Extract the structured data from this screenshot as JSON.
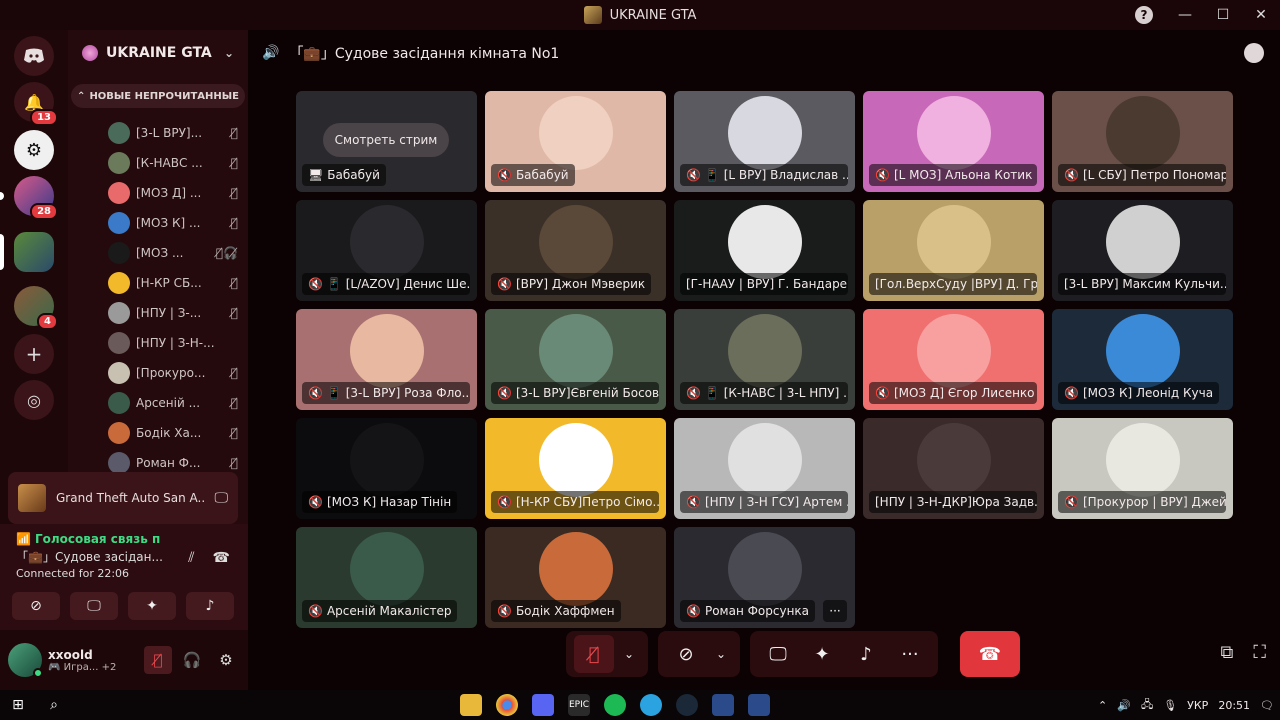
{
  "window": {
    "title": "UKRAINE GTA",
    "help_label": "?",
    "minimize": "—",
    "maximize": "☐",
    "close": "✕"
  },
  "rail": {
    "notifications_badge": "13",
    "server_badge_1": "28",
    "server_badge_2": "4"
  },
  "sidebar": {
    "server_name": "UKRAINE GTA",
    "unread_label": "НОВЫЕ НЕПРОЧИТАННЫЕ",
    "members": [
      {
        "name": "[3-L ВРУ]...",
        "color": "#4a6a5a"
      },
      {
        "name": "[К-НАВС ...",
        "color": "#6a7a5a"
      },
      {
        "name": "[МОЗ Д] ...",
        "color": "#e86a6a"
      },
      {
        "name": "[МОЗ К] ...",
        "color": "#3a7ac8"
      },
      {
        "name": "[МОЗ ...",
        "color": "#1a1a1a"
      },
      {
        "name": "[Н-КР СБ...",
        "color": "#f2b92a"
      },
      {
        "name": "[НПУ | З-...",
        "color": "#9a9a9a"
      },
      {
        "name": "[НПУ | З-Н-...",
        "color": "#6a5a5a"
      },
      {
        "name": "[Прокуро...",
        "color": "#c8c0b0"
      },
      {
        "name": "Арсеній ...",
        "color": "#3a5a4a"
      },
      {
        "name": "Бодік Ха...",
        "color": "#c86a3a"
      },
      {
        "name": "Роман Ф...",
        "color": "#5a5a6a"
      }
    ],
    "activity": "Grand Theft Auto San A...",
    "voice": {
      "status": "Голосовая связь п",
      "room": "「💼」Судове засідан...",
      "connected": "Connected for 22:06"
    },
    "user": {
      "name": "xxoold",
      "status": "🎮 Игра...",
      "extra": "+2"
    }
  },
  "channel": {
    "title": "「💼」Судове засідання кімната No1"
  },
  "stream_button": "Смотреть стрим",
  "tiles": [
    {
      "label": "Бабабуй",
      "bg": "#2a2a2e",
      "avatar": "",
      "icon": "🖥",
      "stream": true
    },
    {
      "label": "Бабабуй",
      "bg": "#e0b8a8",
      "avatar": "#f0d0c0",
      "icon": "🔇"
    },
    {
      "label": "[L ВРУ] Владислав ...",
      "bg": "#5a5a60",
      "avatar": "#d8d8e0",
      "icon": "🔇 📱"
    },
    {
      "label": "[L МОЗ] Альона Котик",
      "bg": "#c868b8",
      "avatar": "#f0b0e0",
      "icon": "🔇"
    },
    {
      "label": "[L СБУ] Петро Пономар...",
      "bg": "#6a5048",
      "avatar": "#4a3a30",
      "icon": "🔇"
    },
    {
      "label": "[L/AZOV] Денис Ше...",
      "bg": "#1a1a1c",
      "avatar": "#2a2a2e",
      "icon": "🔇 📱"
    },
    {
      "label": "[ВРУ] Джон Мэверик",
      "bg": "#3a3028",
      "avatar": "#5a4838",
      "icon": "🔇"
    },
    {
      "label": "[Г-НААУ | ВРУ] Г. Бандаре...",
      "bg": "#1a1c1c",
      "avatar": "#e8e8e8",
      "icon": ""
    },
    {
      "label": "[Гол.ВерхСуду |ВРУ] Д. Гр...",
      "bg": "#b8a068",
      "avatar": "#d8c088",
      "icon": ""
    },
    {
      "label": "[3-L ВРУ] Максим Кульчи...",
      "bg": "#1e1e22",
      "avatar": "#d0d0d0",
      "icon": ""
    },
    {
      "label": "[3-L ВРУ] Роза Фло...",
      "bg": "#a87070",
      "avatar": "#e8b8a0",
      "icon": "🔇 📱"
    },
    {
      "label": "[3-L ВРУ]Євгеній Босов",
      "bg": "#4a5a48",
      "avatar": "#6a8a78",
      "icon": "🔇"
    },
    {
      "label": "[К-НАВС | 3-L НПУ] ...",
      "bg": "#3a3e3a",
      "avatar": "#6a6e5a",
      "icon": "🔇 📱"
    },
    {
      "label": "[МОЗ Д] Єгор Лисенко",
      "bg": "#f07070",
      "avatar": "#f8a0a0",
      "icon": "🔇"
    },
    {
      "label": "[МОЗ К] Леонід Куча",
      "bg": "#1c2a3a",
      "avatar": "#3a8ad8",
      "icon": "🔇"
    },
    {
      "label": "[МОЗ К] Назар Тінін",
      "bg": "#0c0c0e",
      "avatar": "#141416",
      "icon": "🔇"
    },
    {
      "label": "[Н-КР СБУ]Петро Сімо...",
      "bg": "#f2b92a",
      "avatar": "#ffffff",
      "icon": "🔇"
    },
    {
      "label": "[НПУ | З-Н ГСУ] Артем ...",
      "bg": "#b8b8b8",
      "avatar": "#e0e0e0",
      "icon": "🔇"
    },
    {
      "label": "[НПУ | З-Н-ДКР]Юра Задв...",
      "bg": "#3a2a2a",
      "avatar": "#4a3a3a",
      "icon": ""
    },
    {
      "label": "[Прокурор | ВРУ] Джей...",
      "bg": "#c8c8c0",
      "avatar": "#e8e8e0",
      "icon": "🔇"
    },
    {
      "label": "Арсеній Макалістер",
      "bg": "#2a3a2e",
      "avatar": "#3a5a4a",
      "icon": "🔇"
    },
    {
      "label": "Бодік Хаффмен",
      "bg": "#3a2a22",
      "avatar": "#c86a3a",
      "icon": "🔇"
    },
    {
      "label": "Роман Форсунка",
      "bg": "#2a2a30",
      "avatar": "#4a4a52",
      "icon": "🔇",
      "more": "···"
    }
  ],
  "taskbar": {
    "lang": "УКР",
    "time": "20:51",
    "epic_label": "EPIC"
  }
}
